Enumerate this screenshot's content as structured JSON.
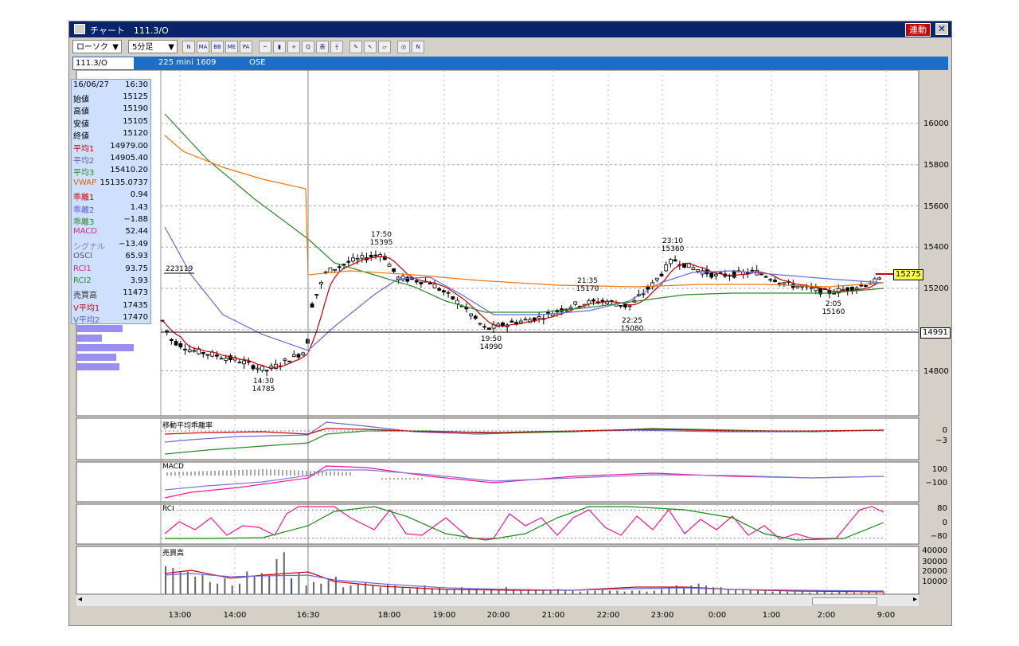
{
  "window": {
    "title": "チャート　111.3/O",
    "link_button": "連動",
    "close_icon": "close-icon"
  },
  "toolbar": {
    "chart_type": "ローソク",
    "interval": "5分足",
    "arrow": "▼",
    "tools": [
      {
        "name": "new-chart-icon",
        "glyph": "N"
      },
      {
        "name": "ma-icon",
        "glyph": "MA"
      },
      {
        "name": "bb-icon",
        "glyph": "BB"
      },
      {
        "name": "me-icon",
        "glyph": "ME"
      },
      {
        "name": "pa-icon",
        "glyph": "PA"
      },
      {
        "name": "line-icon",
        "glyph": "~"
      },
      {
        "name": "candle-icon",
        "glyph": "▮"
      },
      {
        "name": "fit-icon",
        "glyph": "+"
      },
      {
        "name": "zoom-icon",
        "glyph": "Q"
      },
      {
        "name": "display-icon",
        "glyph": "表"
      },
      {
        "name": "bar-icon",
        "glyph": "┼"
      },
      {
        "name": "pen-icon",
        "glyph": "✎"
      },
      {
        "name": "pointer-icon",
        "glyph": "↖"
      },
      {
        "name": "eraser-icon",
        "glyph": "▱"
      },
      {
        "name": "search-icon",
        "glyph": "◎"
      },
      {
        "name": "delete-lines-icon",
        "glyph": "N"
      }
    ]
  },
  "tabs": {
    "symbol": "111.3/O",
    "name": "225 mini 1609",
    "exchange": "OSE"
  },
  "info": {
    "date": "16/06/27",
    "time": "16:30",
    "rows": [
      {
        "label": "始値",
        "value": "15125",
        "color": "#000000"
      },
      {
        "label": "高値",
        "value": "15190",
        "color": "#000000"
      },
      {
        "label": "安値",
        "value": "15105",
        "color": "#000000"
      },
      {
        "label": "終値",
        "value": "15120",
        "color": "#000000"
      },
      {
        "label": "平均1",
        "value": "14979.00",
        "color": "#cc0000"
      },
      {
        "label": "平均2",
        "value": "14905.40",
        "color": "#5a5ad0"
      },
      {
        "label": "平均3",
        "value": "15410.20",
        "color": "#2a8a2a"
      },
      {
        "label": "VWAP",
        "value": "15135.0737",
        "color": "#e06000"
      },
      {
        "label": "乖離1",
        "value": "0.94",
        "color": "#cc0000"
      },
      {
        "label": "乖離2",
        "value": "1.43",
        "color": "#5a5ad0"
      },
      {
        "label": "乖離3",
        "value": "−1.88",
        "color": "#2a8a2a"
      },
      {
        "label": "MACD",
        "value": "52.44",
        "color": "#e0208a"
      },
      {
        "label": "シグナル",
        "value": "−13.49",
        "color": "#7a7ae0"
      },
      {
        "label": "OSCI",
        "value": "65.93",
        "color": "#555555"
      },
      {
        "label": "RCI1",
        "value": "93.75",
        "color": "#e0208a"
      },
      {
        "label": "RCI2",
        "value": "3.93",
        "color": "#2a8a2a"
      },
      {
        "label": "売買高",
        "value": "11473",
        "color": "#333333"
      },
      {
        "label": "V平均1",
        "value": "17435",
        "color": "#cc0000"
      },
      {
        "label": "V平均2",
        "value": "17470",
        "color": "#5a5ad0"
      }
    ]
  },
  "price_axis": {
    "ticks": [
      "16000",
      "15800",
      "15600",
      "15400",
      "15200",
      "14800"
    ],
    "last_price": "15275",
    "cursor_price": "14991"
  },
  "price_pane": {
    "level_label": "223119",
    "highs_lows": [
      {
        "time": "14:30",
        "price": "14785"
      },
      {
        "time": "17:50",
        "price": "15395"
      },
      {
        "time": "19:50",
        "price": "14990"
      },
      {
        "time": "21:35",
        "price": "15170"
      },
      {
        "time": "22:25",
        "price": "15080"
      },
      {
        "time": "23:10",
        "price": "15360"
      },
      {
        "time": "2:05",
        "price": "15160"
      }
    ]
  },
  "panes": {
    "deviation": {
      "label": "移動平均乖離率",
      "ticks": [
        "0",
        "−3"
      ]
    },
    "macd": {
      "label": "MACD",
      "ticks": [
        "100",
        "−100"
      ]
    },
    "rci": {
      "label": "RCI",
      "ticks": [
        "80",
        "0",
        "−80"
      ]
    },
    "volume": {
      "label": "売買高",
      "ticks": [
        "40000",
        "30000",
        "20000",
        "10000"
      ]
    }
  },
  "time_axis": [
    "13:00",
    "14:00",
    "16:30",
    "18:00",
    "19:00",
    "20:00",
    "21:00",
    "22:00",
    "23:00",
    "0:00",
    "1:00",
    "2:00",
    "9:00"
  ],
  "scrollbar": {
    "left": "◂",
    "right": "▸"
  },
  "colors": {
    "ma1": "#cc0000",
    "ma2": "#6a6ae0",
    "ma3": "#2a8a2a",
    "vwap": "#f07810",
    "rci1": "#ff1493",
    "rci2": "#1a8a1a",
    "accent": "#0a246a"
  }
}
